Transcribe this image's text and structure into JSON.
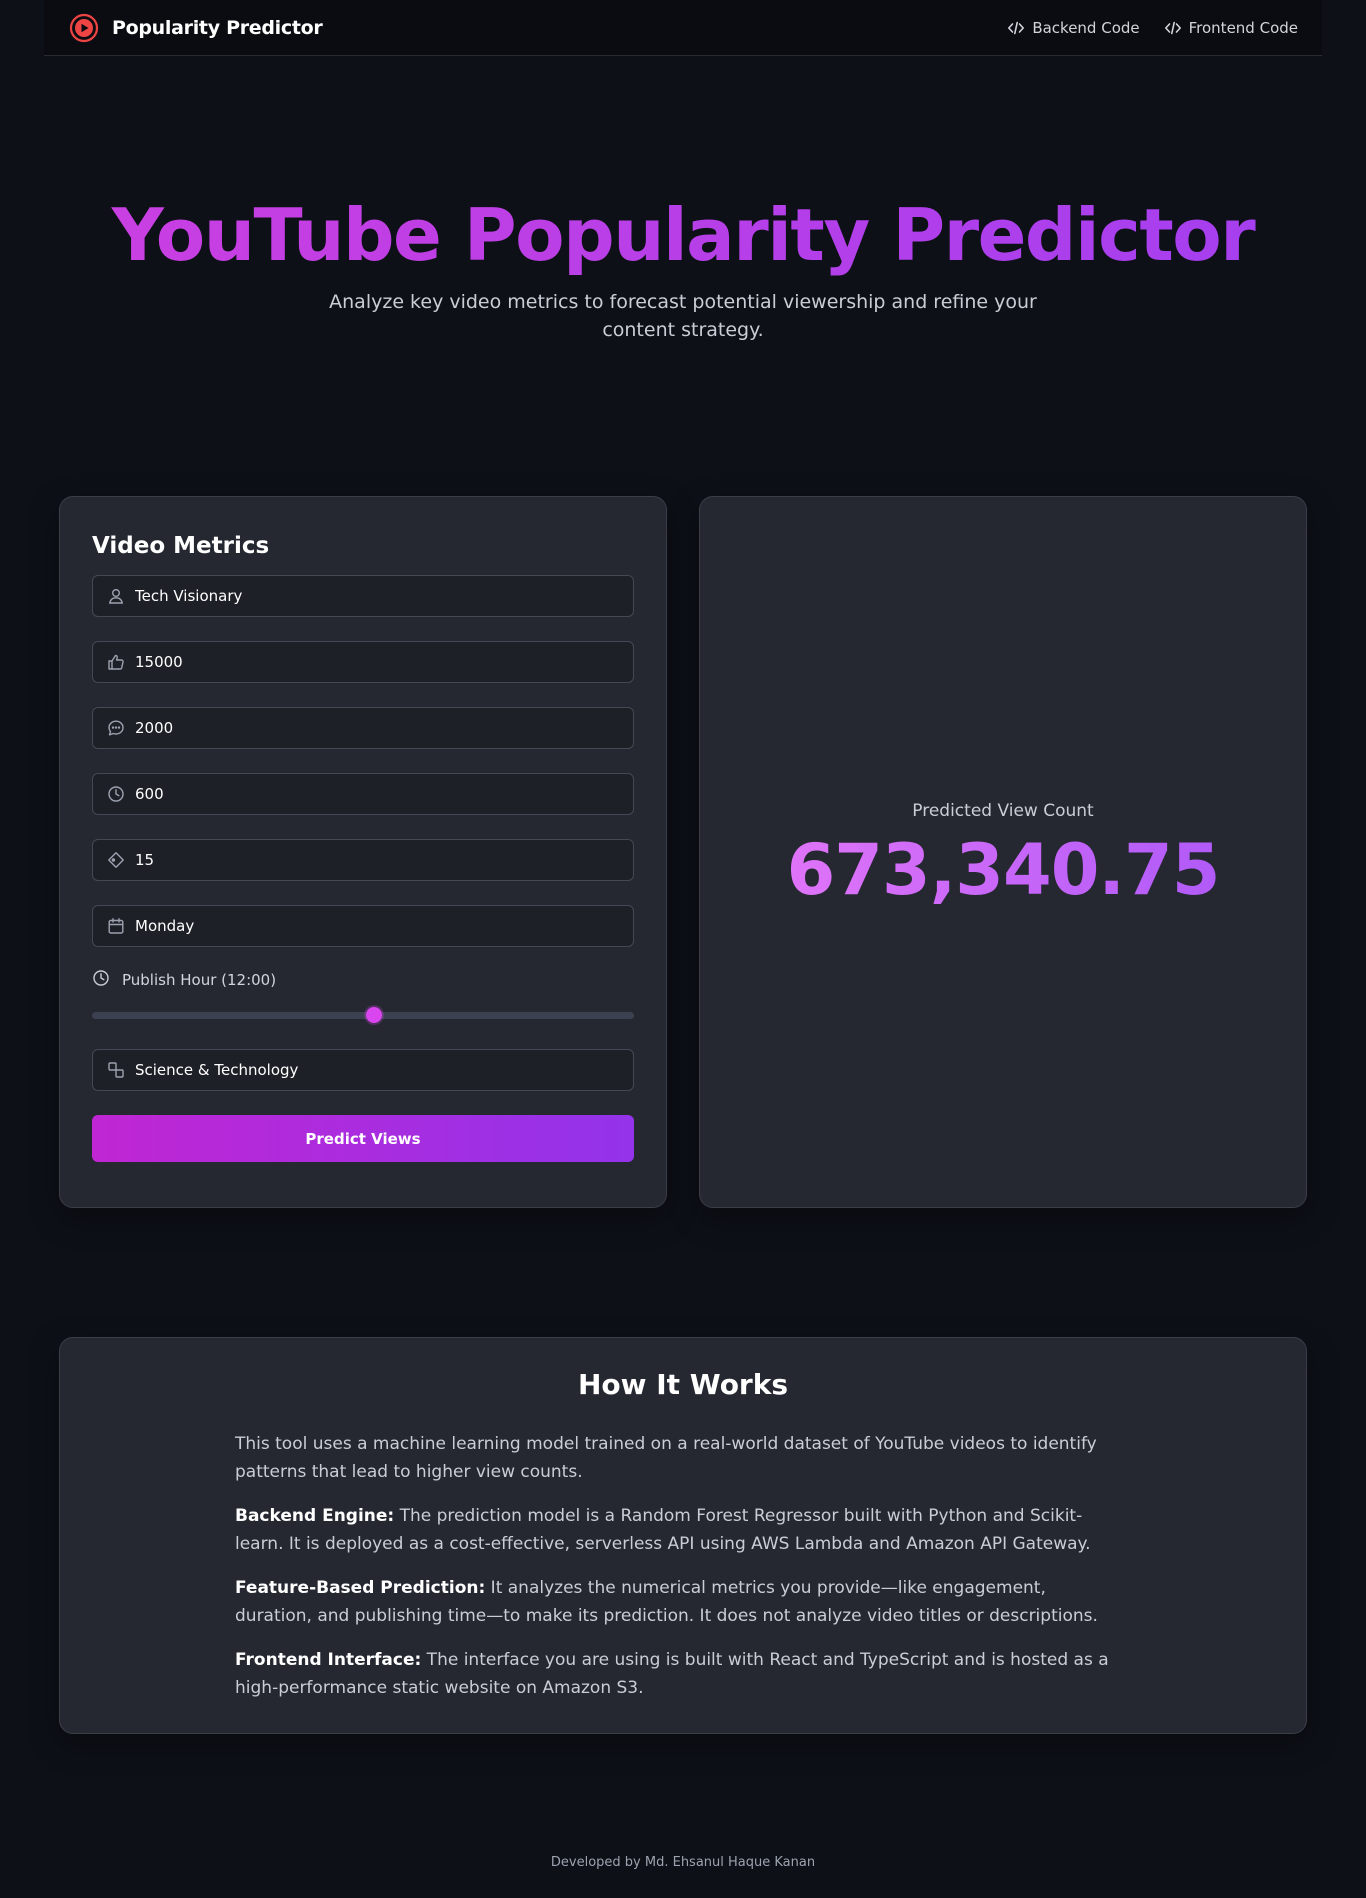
{
  "nav": {
    "brand": "Popularity Predictor",
    "links": [
      {
        "label": "Backend Code",
        "icon": "code-icon"
      },
      {
        "label": "Frontend Code",
        "icon": "code-icon"
      }
    ]
  },
  "hero": {
    "title": "YouTube Popularity Predictor",
    "subtitle": "Analyze key video metrics to forecast potential viewership and refine your content strategy."
  },
  "metrics": {
    "title": "Video Metrics",
    "fields": [
      {
        "icon": "user-icon",
        "value": "Tech Visionary"
      },
      {
        "icon": "thumbs-up-icon",
        "value": "15000"
      },
      {
        "icon": "comment-icon",
        "value": "2000"
      },
      {
        "icon": "clock-icon",
        "value": "600"
      },
      {
        "icon": "tag-icon",
        "value": "15"
      },
      {
        "icon": "calendar-icon",
        "value": "Monday"
      }
    ],
    "publish_hour_label": "Publish Hour (12:00)",
    "publish_hour": 12,
    "publish_hour_range": [
      0,
      23
    ],
    "category": {
      "icon": "shapes-icon",
      "value": "Science & Technology"
    },
    "predict_button": "Predict Views"
  },
  "result": {
    "label": "Predicted View Count",
    "value": "673,340.75"
  },
  "how": {
    "title": "How It Works",
    "intro": "This tool uses a machine learning model trained on a real-world dataset of YouTube videos to identify patterns that lead to higher view counts.",
    "items": [
      {
        "heading": "Backend Engine:",
        "text": " The prediction model is a Random Forest Regressor built with Python and Scikit-learn. It is deployed as a cost-effective, serverless API using AWS Lambda and Amazon API Gateway."
      },
      {
        "heading": "Feature-Based Prediction:",
        "text": " It analyzes the numerical metrics you provide—like engagement, duration, and publishing time—to make its prediction. It does not analyze video titles or descriptions."
      },
      {
        "heading": "Frontend Interface:",
        "text": " The interface you are using is built with React and TypeScript and is hosted as a high-performance static website on Amazon S3."
      }
    ]
  },
  "footer": "Developed by Md. Ehsanul Haque Kanan",
  "colors": {
    "accent_start": "#c026d3",
    "accent_end": "#9333ea",
    "background": "#0d1017",
    "card": "#252831",
    "brand_icon": "#ef4444"
  }
}
